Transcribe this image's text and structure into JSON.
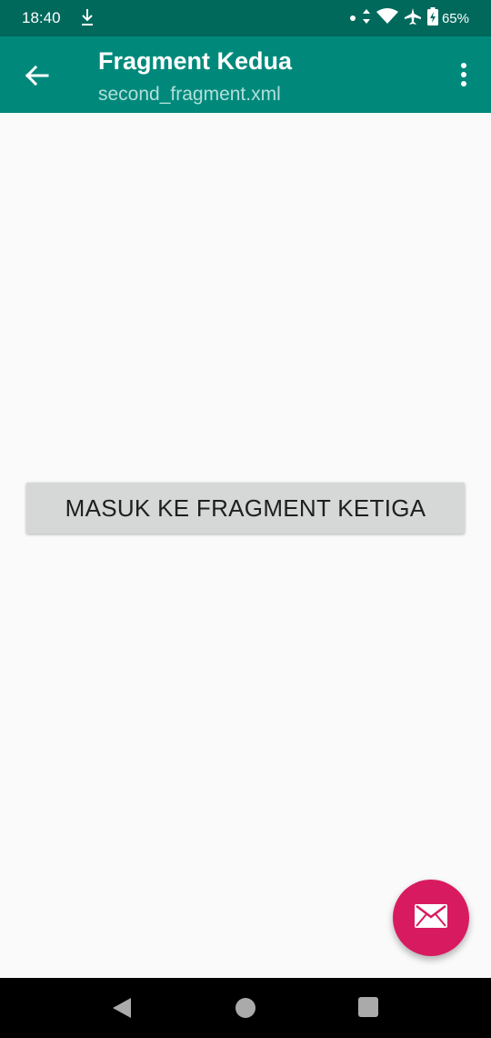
{
  "status_bar": {
    "time": "18:40",
    "battery": "65%",
    "icons": [
      "download-icon",
      "notification-dot-icon",
      "data-arrows-icon",
      "wifi-icon",
      "airplane-icon",
      "battery-icon"
    ]
  },
  "app_bar": {
    "title": "Fragment Kedua",
    "subtitle": "second_fragment.xml",
    "navigation_icon": "arrow-back-icon",
    "menu_icon": "overflow-menu-icon",
    "color": "#00897b"
  },
  "main": {
    "button_label": "MASUK KE FRAGMENT KETIGA"
  },
  "fab": {
    "icon": "mail-icon",
    "color": "#d81b60"
  },
  "nav_bar": {
    "buttons": [
      "back-triangle-icon",
      "home-circle-icon",
      "recents-square-icon"
    ]
  }
}
